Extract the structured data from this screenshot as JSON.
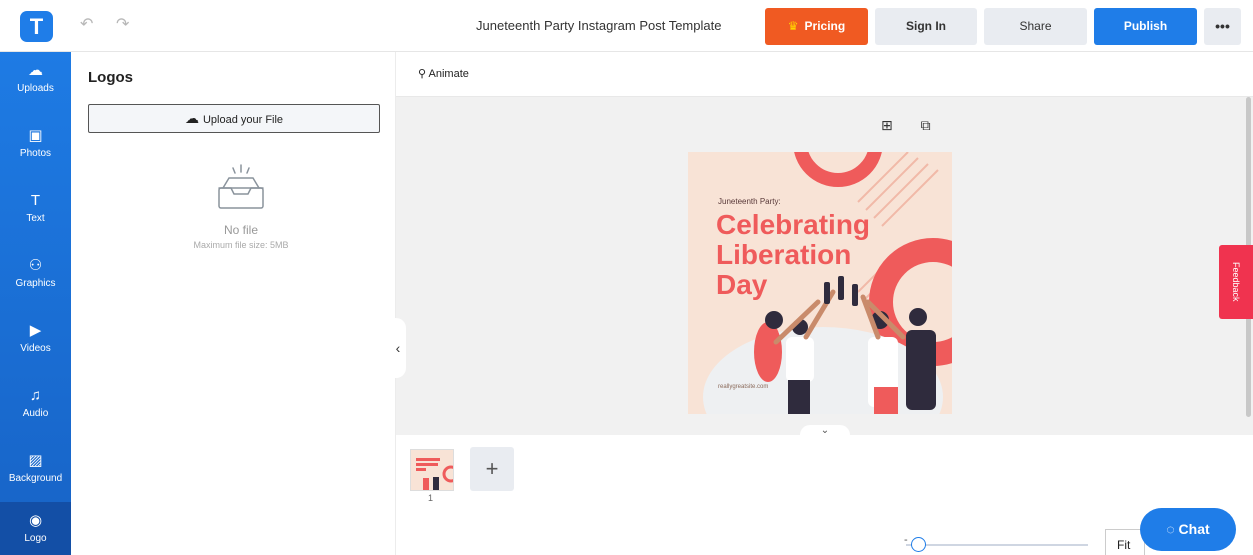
{
  "app": {
    "logo_letter": "T"
  },
  "header": {
    "undo_icon": "↶",
    "redo_icon": "↷",
    "title": "Juneteenth Party Instagram Post Template",
    "pricing_label": "Pricing",
    "pricing_icon": "♛",
    "signin_label": "Sign In",
    "share_label": "Share",
    "publish_label": "Publish",
    "more_label": "•••"
  },
  "sidebar": {
    "items": [
      {
        "label": "Uploads",
        "icon": "☁"
      },
      {
        "label": "Photos",
        "icon": "▣"
      },
      {
        "label": "Text",
        "icon": "T"
      },
      {
        "label": "Graphics",
        "icon": "⚇"
      },
      {
        "label": "Videos",
        "icon": "▶"
      },
      {
        "label": "Audio",
        "icon": "♫"
      },
      {
        "label": "Background",
        "icon": "▨"
      },
      {
        "label": "Logo",
        "icon": "◉"
      }
    ]
  },
  "panel": {
    "title": "Logos",
    "upload_label": "Upload your File",
    "upload_icon": "☁",
    "empty_title": "No file",
    "empty_hint": "Maximum file size: 5MB"
  },
  "toolbar": {
    "animate_label": "Animate",
    "animate_icon": "⚲"
  },
  "canvas": {
    "add_icon": "⊞",
    "copy_icon": "⧉",
    "post_subtitle": "Juneteenth Party:",
    "post_headline_1": "Celebrating",
    "post_headline_2": "Liberation",
    "post_headline_3": "Day",
    "post_url": "reallygreatsite.com",
    "collapse_icon": "‹",
    "expand_icon": "⌄"
  },
  "pages": {
    "page_number": "1",
    "add_page_label": "+"
  },
  "feedback_label": "Feedback",
  "zoom": {
    "minus_label": "-",
    "fit_label": "Fit"
  },
  "chat": {
    "label": "Chat",
    "icon": "◌"
  },
  "colors": {
    "brand_blue": "#1f7de8",
    "pricing_orange": "#f05a22",
    "accent_coral": "#ef5b5b",
    "feedback_red": "#f0334f"
  }
}
